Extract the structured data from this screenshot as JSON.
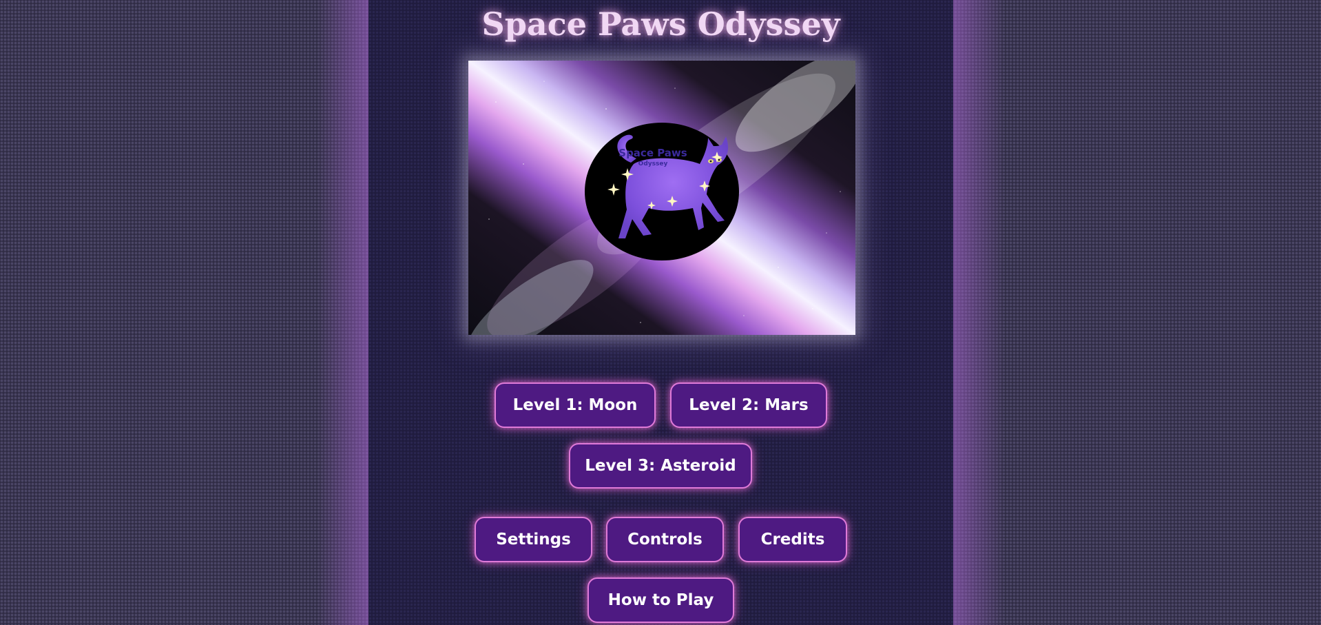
{
  "title": "Space Paws Odyssey",
  "hero": {
    "logo_title": "Space Paws",
    "logo_subtitle": "Odyssey"
  },
  "levels": [
    {
      "label": "Level 1: Moon"
    },
    {
      "label": "Level 2: Mars"
    },
    {
      "label": "Level 3: Asteroid"
    }
  ],
  "menu": [
    {
      "label": "Settings"
    },
    {
      "label": "Controls"
    },
    {
      "label": "Credits"
    },
    {
      "label": "How to Play"
    }
  ],
  "colors": {
    "button_fill": "#4e1a82",
    "button_border": "#e07ad8",
    "title_text": "#f1d8f4",
    "panel_bg": "#201c3e"
  },
  "icons": [
    "cat-icon",
    "sparkle-icon"
  ]
}
